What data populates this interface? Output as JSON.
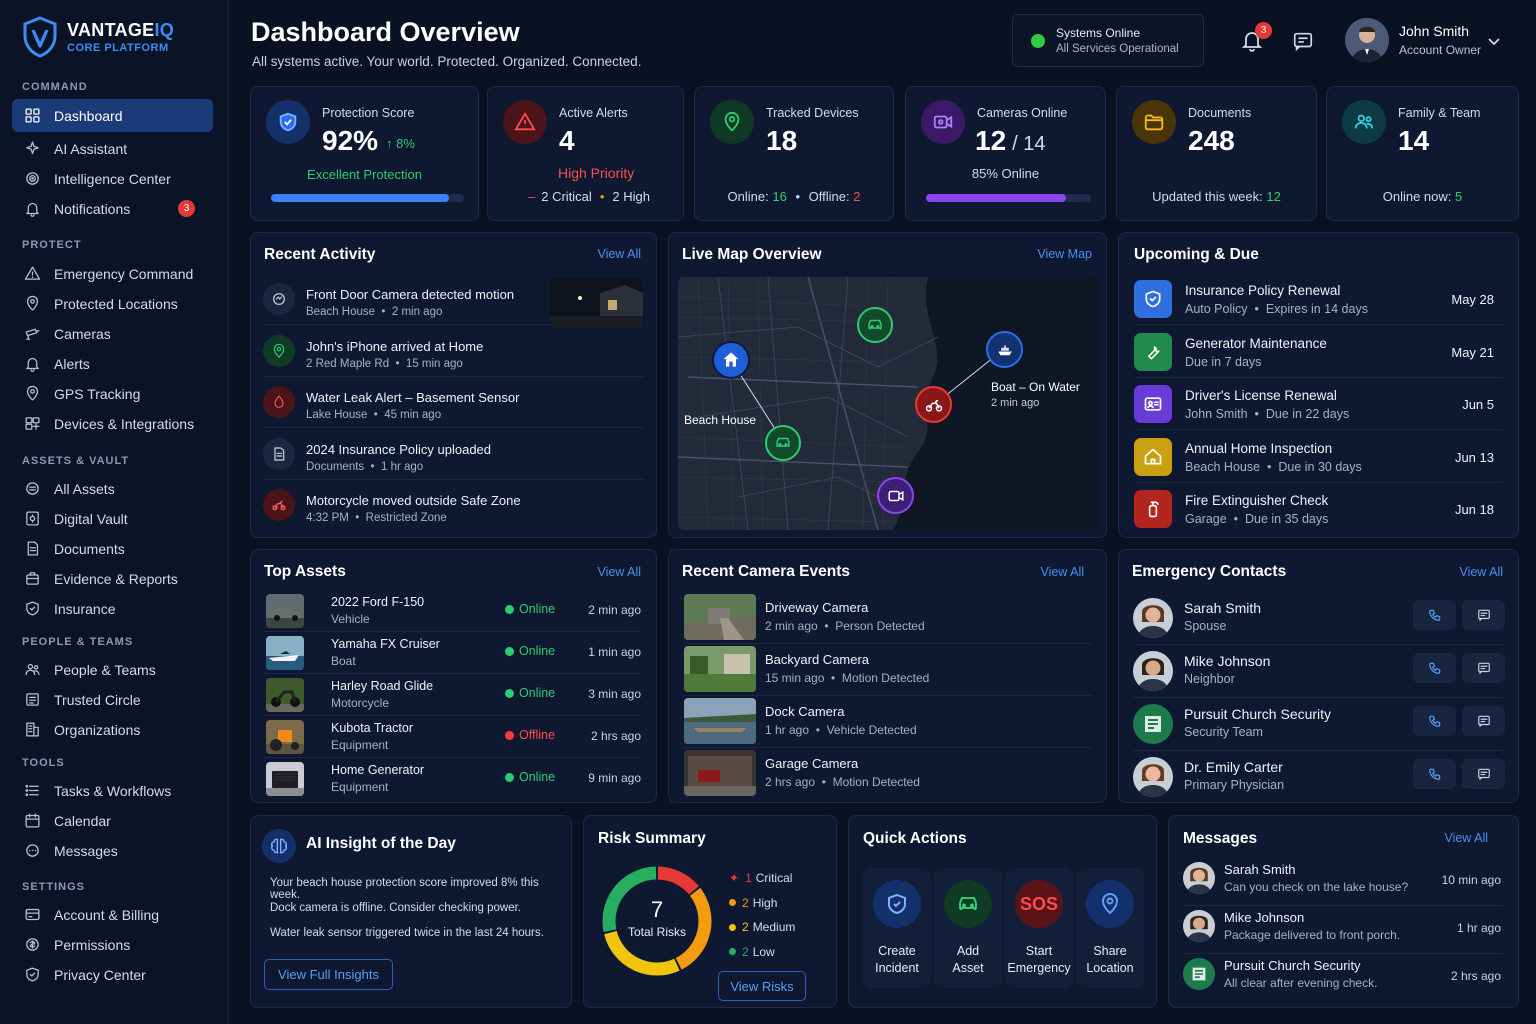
{
  "brand": {
    "name_main": "VANTAGE",
    "name_accent": "IQ",
    "subtitle": "CORE PLATFORM"
  },
  "sidebar": {
    "sections": [
      "COMMAND",
      "PROTECT",
      "ASSETS & VAULT",
      "PEOPLE & TEAMS",
      "TOOLS",
      "SETTINGS"
    ],
    "items": [
      {
        "label": "Dashboard",
        "icon": "dashboard-icon"
      },
      {
        "label": "AI Assistant",
        "icon": "sparkle-icon"
      },
      {
        "label": "Intelligence Center",
        "icon": "target-icon"
      },
      {
        "label": "Notifications",
        "icon": "bell-icon",
        "badge": "3"
      },
      {
        "label": "Emergency Command",
        "icon": "warning-icon"
      },
      {
        "label": "Protected Locations",
        "icon": "location-pin-icon"
      },
      {
        "label": "Cameras",
        "icon": "camera-icon"
      },
      {
        "label": "Alerts",
        "icon": "bell-icon"
      },
      {
        "label": "GPS Tracking",
        "icon": "location-pin-icon"
      },
      {
        "label": "Devices & Integrations",
        "icon": "devices-icon"
      },
      {
        "label": "All Assets",
        "icon": "layers-icon"
      },
      {
        "label": "Digital Vault",
        "icon": "vault-icon"
      },
      {
        "label": "Documents",
        "icon": "document-icon"
      },
      {
        "label": "Evidence & Reports",
        "icon": "briefcase-icon"
      },
      {
        "label": "Insurance",
        "icon": "shield-icon"
      },
      {
        "label": "People & Teams",
        "icon": "people-icon"
      },
      {
        "label": "Trusted Circle",
        "icon": "circle-people-icon"
      },
      {
        "label": "Organizations",
        "icon": "building-icon"
      },
      {
        "label": "Tasks & Workflows",
        "icon": "list-icon"
      },
      {
        "label": "Calendar",
        "icon": "calendar-icon"
      },
      {
        "label": "Messages",
        "icon": "chat-icon"
      },
      {
        "label": "Account & Billing",
        "icon": "card-icon"
      },
      {
        "label": "Permissions",
        "icon": "key-icon"
      },
      {
        "label": "Privacy Center",
        "icon": "shield-icon"
      }
    ]
  },
  "header": {
    "title": "Dashboard Overview",
    "subtitle": "All systems active. Your world. Protected. Organized. Connected.",
    "status_title": "Systems Online",
    "status_sub": "All Services Operational",
    "notif_count": "3",
    "user_name": "John Smith",
    "user_role": "Account Owner"
  },
  "stats": {
    "protection": {
      "label": "Protection Score",
      "value": "92%",
      "delta": "↑ 8%",
      "note": "Excellent Protection",
      "progress": 0.92,
      "color": "#3b82f6"
    },
    "alerts": {
      "label": "Active Alerts",
      "value": "4",
      "priority": "High Priority",
      "critical": "2 Critical",
      "high": "2 High"
    },
    "devices": {
      "label": "Tracked Devices",
      "value": "18",
      "online_label": "Online:",
      "online": "16",
      "offline_label": "Offline:",
      "offline": "2"
    },
    "cameras": {
      "label": "Cameras Online",
      "value": "12",
      "total": "/ 14",
      "note": "85% Online",
      "progress": 0.85
    },
    "documents": {
      "label": "Documents",
      "value": "248",
      "note_label": "Updated this week:",
      "note_value": "12"
    },
    "family": {
      "label": "Family & Team",
      "value": "14",
      "note_label": "Online now:",
      "note_value": "5"
    }
  },
  "recent_activity": {
    "title": "Recent Activity",
    "view_all": "View All",
    "items": [
      {
        "title": "Front Door Camera detected motion",
        "loc": "Beach House",
        "time": "2 min ago",
        "icon": "motion-icon"
      },
      {
        "title": "John's iPhone arrived at Home",
        "loc": "2 Red Maple Rd",
        "time": "15 min ago",
        "icon": "location-pin-icon"
      },
      {
        "title": "Water Leak Alert – Basement Sensor",
        "loc": "Lake House",
        "time": "45 min ago",
        "icon": "water-drop-icon"
      },
      {
        "title": "2024 Insurance Policy uploaded",
        "loc": "Documents",
        "time": "1 hr ago",
        "icon": "document-icon"
      },
      {
        "title": "Motorcycle moved outside Safe Zone",
        "loc": "4:32 PM",
        "time": "Restricted Zone",
        "icon": "motorcycle-icon"
      }
    ]
  },
  "live_map": {
    "title": "Live Map Overview",
    "view": "View Map",
    "beach_label": "Beach House",
    "boat_label": "Boat – On Water",
    "boat_time": "2 min ago"
  },
  "upcoming": {
    "title": "Upcoming & Due",
    "items": [
      {
        "title": "Insurance Policy Renewal",
        "sub1": "Auto Policy",
        "sub2": "Expires in 14 days",
        "date": "May 28",
        "icon": "shield-icon",
        "color": "#2f6fe0"
      },
      {
        "title": "Generator Maintenance",
        "sub1": "Due in 7 days",
        "sub2": "",
        "date": "May 21",
        "icon": "wrench-icon",
        "color": "#1f8a4c"
      },
      {
        "title": "Driver's License Renewal",
        "sub1": "John Smith",
        "sub2": "Due in 22 days",
        "date": "Jun 5",
        "icon": "id-card-icon",
        "color": "#6a3bd6"
      },
      {
        "title": "Annual Home Inspection",
        "sub1": "Beach House",
        "sub2": "Due in 30 days",
        "date": "Jun 13",
        "icon": "home-icon",
        "color": "#c9a00f"
      },
      {
        "title": "Fire Extinguisher Check",
        "sub1": "Garage",
        "sub2": "Due in 35 days",
        "date": "Jun 18",
        "icon": "fire-extinguisher-icon",
        "color": "#b3261e"
      }
    ]
  },
  "top_assets": {
    "title": "Top Assets",
    "view_all": "View All",
    "items": [
      {
        "name": "2022 Ford F-150",
        "type": "Vehicle",
        "status": "Online",
        "time": "2 min ago"
      },
      {
        "name": "Yamaha FX Cruiser",
        "type": "Boat",
        "status": "Online",
        "time": "1 min ago"
      },
      {
        "name": "Harley Road Glide",
        "type": "Motorcycle",
        "status": "Online",
        "time": "3 min ago"
      },
      {
        "name": "Kubota Tractor",
        "type": "Equipment",
        "status": "Offline",
        "time": "2 hrs ago"
      },
      {
        "name": "Home Generator",
        "type": "Equipment",
        "status": "Online",
        "time": "9 min ago"
      }
    ]
  },
  "camera_events": {
    "title": "Recent Camera Events",
    "view_all": "View All",
    "items": [
      {
        "name": "Driveway Camera",
        "time": "2 min ago",
        "event": "Person Detected"
      },
      {
        "name": "Backyard Camera",
        "time": "15 min ago",
        "event": "Motion Detected"
      },
      {
        "name": "Dock Camera",
        "time": "1 hr ago",
        "event": "Vehicle Detected"
      },
      {
        "name": "Garage Camera",
        "time": "2 hrs ago",
        "event": "Motion Detected"
      }
    ]
  },
  "contacts": {
    "title": "Emergency Contacts",
    "view_all": "View All",
    "items": [
      {
        "name": "Sarah Smith",
        "role": "Spouse"
      },
      {
        "name": "Mike Johnson",
        "role": "Neighbor"
      },
      {
        "name": "Pursuit Church Security",
        "role": "Security Team"
      },
      {
        "name": "Dr. Emily Carter",
        "role": "Primary Physician"
      }
    ]
  },
  "ai_insight": {
    "title": "AI Insight of the Day",
    "lines": [
      "Your beach house protection score improved 8% this week.",
      "Dock camera is offline. Consider checking power.",
      "Water leak sensor triggered twice in the last 24 hours."
    ],
    "button": "View Full Insights"
  },
  "risk": {
    "title": "Risk Summary",
    "total": "7",
    "total_label": "Total Risks",
    "legend": [
      {
        "num": "1",
        "label": "Critical",
        "color": "#e53935",
        "value": 1
      },
      {
        "num": "2",
        "label": "High",
        "color": "#f39c12",
        "value": 2
      },
      {
        "num": "2",
        "label": "Medium",
        "color": "#f1c40f",
        "value": 2
      },
      {
        "num": "2",
        "label": "Low",
        "color": "#27ae60",
        "value": 2
      }
    ],
    "button": "View Risks"
  },
  "quick_actions": {
    "title": "Quick Actions",
    "items": [
      {
        "label": "Create\nIncident",
        "icon": "shield-icon"
      },
      {
        "label": "Add\nAsset",
        "icon": "car-icon"
      },
      {
        "label": "Start\nEmergency",
        "icon": "sos-icon",
        "sos": "SOS"
      },
      {
        "label": "Share\nLocation",
        "icon": "location-pin-icon"
      }
    ]
  },
  "messages": {
    "title": "Messages",
    "view_all": "View All",
    "items": [
      {
        "name": "Sarah Smith",
        "text": "Can you check on the lake house?",
        "time": "10 min ago"
      },
      {
        "name": "Mike Johnson",
        "text": "Package delivered to front porch.",
        "time": "1 hr ago"
      },
      {
        "name": "Pursuit Church Security",
        "text": "All clear after evening check.",
        "time": "2 hrs ago"
      }
    ]
  }
}
